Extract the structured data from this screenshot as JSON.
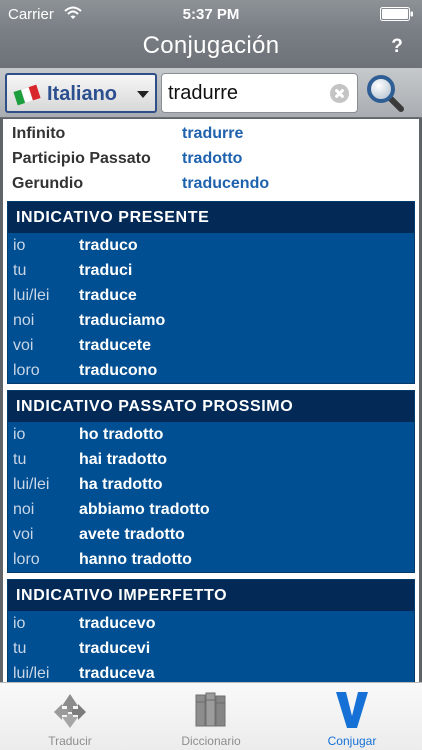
{
  "status": {
    "carrier": "Carrier",
    "time": "5:37 PM"
  },
  "nav": {
    "title": "Conjugación",
    "help_label": "?"
  },
  "toolbar": {
    "language": "Italiano",
    "search_value": "tradurre"
  },
  "info": [
    {
      "label": "Infinito",
      "value": "tradurre"
    },
    {
      "label": "Participio Passato",
      "value": "tradotto"
    },
    {
      "label": "Gerundio",
      "value": "traducendo"
    }
  ],
  "tenses": [
    {
      "title": "INDICATIVO PRESENTE",
      "rows": [
        {
          "pronoun": "io",
          "form": "traduco"
        },
        {
          "pronoun": "tu",
          "form": "traduci"
        },
        {
          "pronoun": "lui/lei",
          "form": "traduce"
        },
        {
          "pronoun": "noi",
          "form": "traduciamo"
        },
        {
          "pronoun": "voi",
          "form": "traducete"
        },
        {
          "pronoun": "loro",
          "form": "traducono"
        }
      ]
    },
    {
      "title": "INDICATIVO PASSATO PROSSIMO",
      "rows": [
        {
          "pronoun": "io",
          "form": "ho tradotto"
        },
        {
          "pronoun": "tu",
          "form": "hai tradotto"
        },
        {
          "pronoun": "lui/lei",
          "form": "ha tradotto"
        },
        {
          "pronoun": "noi",
          "form": "abbiamo tradotto"
        },
        {
          "pronoun": "voi",
          "form": "avete tradotto"
        },
        {
          "pronoun": "loro",
          "form": "hanno tradotto"
        }
      ]
    },
    {
      "title": "INDICATIVO IMPERFETTO",
      "rows": [
        {
          "pronoun": "io",
          "form": "traducevo"
        },
        {
          "pronoun": "tu",
          "form": "traducevi"
        },
        {
          "pronoun": "lui/lei",
          "form": "traduceva"
        }
      ]
    }
  ],
  "tabs": [
    {
      "label": "Traducir",
      "icon": "translate-icon",
      "active": false
    },
    {
      "label": "Diccionario",
      "icon": "books-icon",
      "active": false
    },
    {
      "label": "Conjugar",
      "icon": "conjugate-v-icon",
      "active": true
    }
  ],
  "colors": {
    "nav_gradient": "#7a7f85",
    "tense_header": "#032a57",
    "tense_body": "#004f92",
    "info_value": "#1f62ad",
    "tab_active": "#1671d6"
  }
}
